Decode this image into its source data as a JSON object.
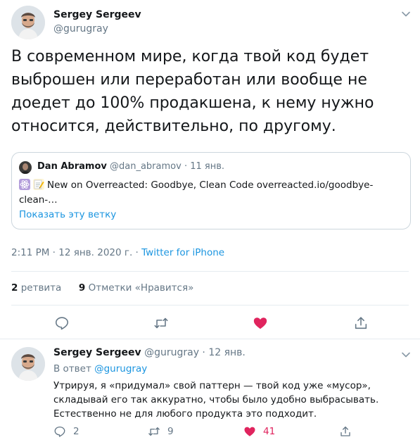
{
  "main_tweet": {
    "author_name": "Sergey Sergeev",
    "author_handle": "@gurugray",
    "text": "В современном мире, когда твой код будет выброшен или переработан или вообще не доедет до 100% продакшена, к нему нужно относится, действительно, по другому.",
    "timestamp": "2:11 PM · 12 янв. 2020 г. · ",
    "source": "Twitter for iPhone",
    "retweet_count": "2",
    "retweet_label": "ретвита",
    "like_count": "9",
    "like_label": "Отметки «Нравится»"
  },
  "quoted_tweet": {
    "author_name": "Dan Abramov",
    "author_handle": "@dan_abramov",
    "date": " · 11 янв.",
    "text": "New on Overreacted: Goodbye, Clean Code overreacted.io/goodbye-clean-…",
    "emojis": [
      "atom-emoji",
      "memo-emoji"
    ],
    "show_thread": "Показать эту ветку"
  },
  "reply": {
    "author_name": "Sergey Sergeev",
    "author_handle": "@gurugray",
    "date": " · 12 янв.",
    "reply_to_label": "В ответ ",
    "reply_to_handle": "@gurugray",
    "text": "Утрируя, я «придумал» свой паттерн — твой код уже «мусор», складывай его так аккуратно, чтобы было удобно выбрасывать. Естественно не для любого продукта это подходит.",
    "reply_count": "2",
    "retweet_count": "9",
    "like_count": "41"
  },
  "icons": {
    "reply": "reply-icon",
    "retweet": "retweet-icon",
    "like": "heart-icon",
    "share": "share-icon",
    "menu": "chevron-down-icon"
  },
  "colors": {
    "accent": "#1b95e0",
    "like": "#e0245e",
    "muted": "#657786",
    "text": "#14171a",
    "border": "#e6ecf0"
  }
}
